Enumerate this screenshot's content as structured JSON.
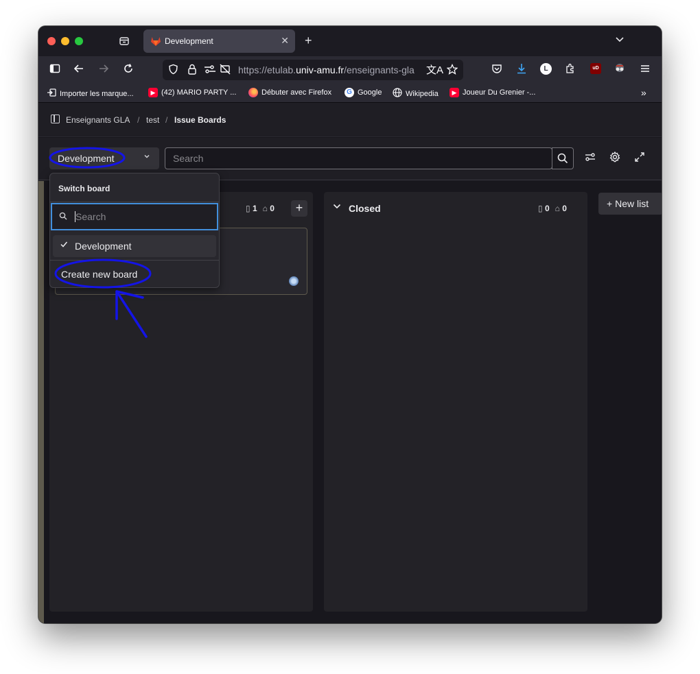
{
  "browser": {
    "tab_title": "Development",
    "url_prefix": "https://etulab.",
    "url_domain": "univ-amu.fr",
    "url_path": "/enseignants-gla",
    "bookmarks": [
      {
        "label": "Importer les marque...",
        "icon": "import-icon"
      },
      {
        "label": "(42) MARIO PARTY ...",
        "icon": "youtube-icon"
      },
      {
        "label": "Débuter avec Firefox",
        "icon": "firefox-icon"
      },
      {
        "label": "Google",
        "icon": "google-icon"
      },
      {
        "label": "Wikipedia",
        "icon": "globe-icon"
      },
      {
        "label": "Joueur Du Grenier -...",
        "icon": "youtube-icon"
      }
    ],
    "profile_initial": "L",
    "ublock_label": "uD"
  },
  "breadcrumb": {
    "group": "Enseignants GLA",
    "project": "test",
    "current": "Issue Boards",
    "separator": "/"
  },
  "filter": {
    "board_selector_label": "Development",
    "search_placeholder": "Search"
  },
  "board": {
    "lists": [
      {
        "title": "",
        "issues": "1",
        "weight": "0"
      },
      {
        "title": "Closed",
        "issues": "0",
        "weight": "0"
      }
    ],
    "new_list_label": "New list"
  },
  "switch_board": {
    "header": "Switch board",
    "search_placeholder": "Search",
    "items": [
      {
        "label": "Development",
        "selected": true
      }
    ],
    "create_label": "Create new board"
  },
  "colors": {
    "annotation": "#1414e6",
    "focus": "#428fdc"
  }
}
